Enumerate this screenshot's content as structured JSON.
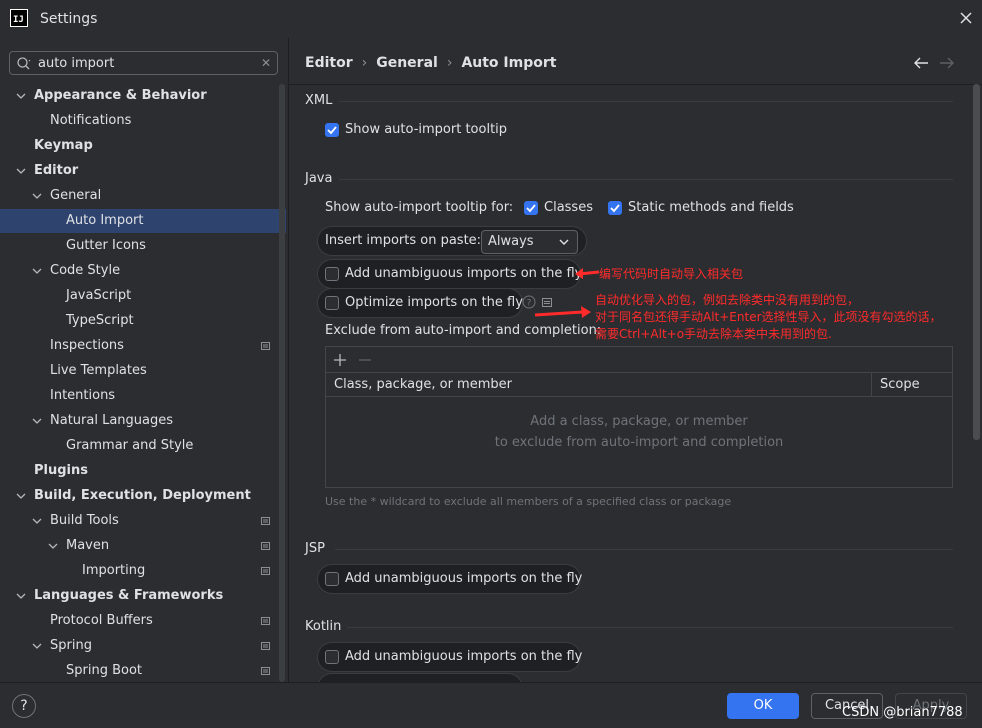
{
  "window": {
    "title": "Settings",
    "logo": "IJ"
  },
  "search": {
    "value": "auto import"
  },
  "sidebar": {
    "items": [
      {
        "label": "Appearance & Behavior",
        "level": 0,
        "expanded": true,
        "bold": true
      },
      {
        "label": "Notifications",
        "level": 1
      },
      {
        "label": "Keymap",
        "level": 0,
        "bold": true
      },
      {
        "label": "Editor",
        "level": 0,
        "expanded": true,
        "bold": true
      },
      {
        "label": "General",
        "level": 1,
        "expanded": true
      },
      {
        "label": "Auto Import",
        "level": 2,
        "selected": true
      },
      {
        "label": "Gutter Icons",
        "level": 2
      },
      {
        "label": "Code Style",
        "level": 1,
        "expanded": true
      },
      {
        "label": "JavaScript",
        "level": 2
      },
      {
        "label": "TypeScript",
        "level": 2
      },
      {
        "label": "Inspections",
        "level": 1,
        "modified": true
      },
      {
        "label": "Live Templates",
        "level": 1
      },
      {
        "label": "Intentions",
        "level": 1
      },
      {
        "label": "Natural Languages",
        "level": 1,
        "expanded": true
      },
      {
        "label": "Grammar and Style",
        "level": 2
      },
      {
        "label": "Plugins",
        "level": 0,
        "bold": true
      },
      {
        "label": "Build, Execution, Deployment",
        "level": 0,
        "expanded": true,
        "bold": true
      },
      {
        "label": "Build Tools",
        "level": 1,
        "expanded": true,
        "modified": true
      },
      {
        "label": "Maven",
        "level": 2,
        "expanded": true,
        "modified": true
      },
      {
        "label": "Importing",
        "level": 3,
        "modified": true
      },
      {
        "label": "Languages & Frameworks",
        "level": 0,
        "expanded": true,
        "bold": true
      },
      {
        "label": "Protocol Buffers",
        "level": 1,
        "modified": true
      },
      {
        "label": "Spring",
        "level": 1,
        "expanded": true,
        "modified": true
      },
      {
        "label": "Spring Boot",
        "level": 2,
        "modified": true
      }
    ]
  },
  "breadcrumb": [
    "Editor",
    "General",
    "Auto Import"
  ],
  "xml": {
    "title": "XML",
    "show_tooltip": {
      "label": "Show auto-import tooltip",
      "checked": true
    }
  },
  "java": {
    "title": "Java",
    "tooltip_for_label": "Show auto-import tooltip for:",
    "classes": {
      "label": "Classes",
      "checked": true
    },
    "static_methods": {
      "label": "Static methods and fields",
      "checked": true
    },
    "insert_imports_label": "Insert imports on paste:",
    "insert_imports_value": "Always",
    "add_unambiguous": {
      "label": "Add unambiguous imports on the fly",
      "checked": false
    },
    "optimize": {
      "label": "Optimize imports on the fly",
      "checked": false
    },
    "exclude_label": "Exclude from auto-import and completion:",
    "table": {
      "col_member": "Class, package, or member",
      "col_scope": "Scope",
      "empty_line1": "Add a class, package, or member",
      "empty_line2": "to exclude from auto-import and completion"
    },
    "hint": "Use the * wildcard to exclude all members of a specified class or package"
  },
  "jsp": {
    "title": "JSP",
    "add_unambiguous": {
      "label": "Add unambiguous imports on the fly",
      "checked": false
    }
  },
  "kotlin": {
    "title": "Kotlin",
    "add_unambiguous": {
      "label": "Add unambiguous imports on the fly",
      "checked": false
    }
  },
  "annotations": {
    "note1": "编写代码时自动导入相关包",
    "note2_line1": "自动优化导入的包，例如去除类中没有用到的包，",
    "note2_line2": "对于同名包还得手动Alt+Enter选择性导入，此项没有勾选的话，",
    "note2_line3": "需要Ctrl+Alt+o手动去除本类中未用到的包."
  },
  "buttons": {
    "ok": "OK",
    "cancel": "Cancel",
    "apply": "Apply",
    "help": "?"
  },
  "watermark": "CSDN @brian7788",
  "colors": {
    "accent": "#3574f0",
    "selection": "#2e436e",
    "annotation": "#ff2b2b"
  }
}
